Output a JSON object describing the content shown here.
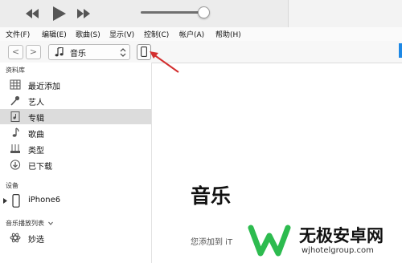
{
  "menu": [
    "文件(F)",
    "编辑(E)",
    "歌曲(S)",
    "显示(V)",
    "控制(C)",
    "帐户(A)",
    "帮助(H)"
  ],
  "toolbar": {
    "back": "<",
    "forward": ">",
    "media_kind": "音乐"
  },
  "sidebar": {
    "library_header": "资料库",
    "library_items": [
      "最近添加",
      "艺人",
      "专辑",
      "歌曲",
      "类型",
      "已下载"
    ],
    "devices_header": "设备",
    "device_name": "iPhone6",
    "playlists_header": "音乐播放列表",
    "playlist_items": [
      "妙选"
    ]
  },
  "main": {
    "title": "音乐",
    "desc": "您添加到 iT"
  },
  "watermark": {
    "title": "无极安卓网",
    "url": "wjhotelgroup.com"
  },
  "colors": {
    "accent": "#1e88e5",
    "arrow": "#d32f2f",
    "logo_green": "#2dbb4f",
    "selected_row": "#dcdcdc"
  }
}
